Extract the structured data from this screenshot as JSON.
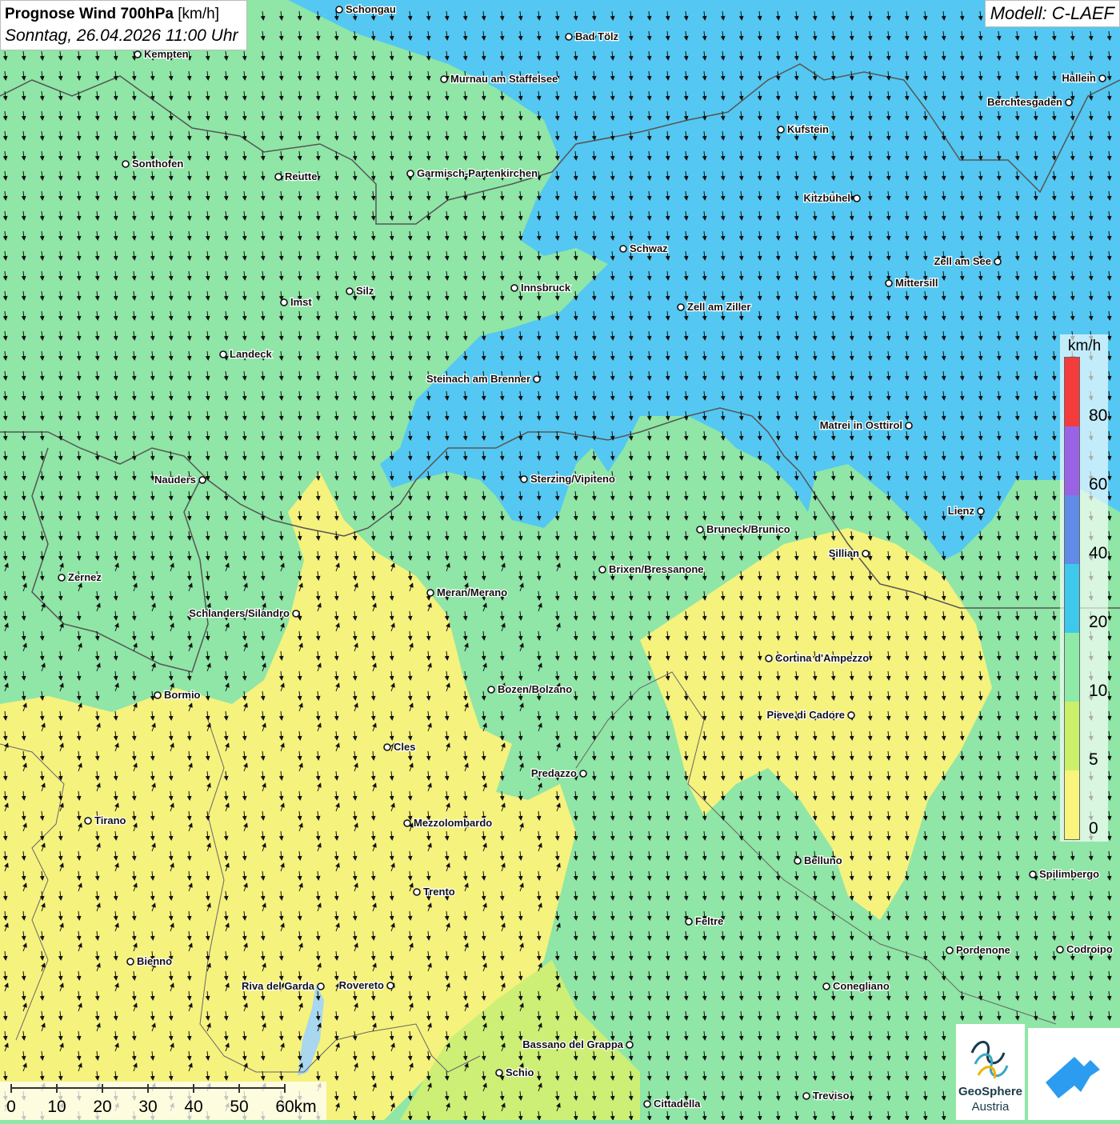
{
  "title": {
    "main_bold": "Prognose Wind 700hPa",
    "main_unit": "[km/h]",
    "date": "Sonntag, 26.04.2026 11:00 Uhr"
  },
  "model": "Modell: C-LAEF",
  "legend": {
    "unit": "km/h",
    "labels": [
      "80",
      "60",
      "40",
      "20",
      "10",
      "5",
      "0"
    ],
    "colors": [
      "#f53c3c",
      "#9a63e6",
      "#5f8ce6",
      "#3ec8ec",
      "#8eeaa6",
      "#cbf06a",
      "#f8f47c"
    ]
  },
  "scale_bar": {
    "labels": [
      "0",
      "10",
      "20",
      "30",
      "40",
      "50",
      "60km"
    ]
  },
  "cities": [
    {
      "name": "Schongau"
    },
    {
      "name": "Bad Tölz"
    },
    {
      "name": "Kempten"
    },
    {
      "name": "Murnau am Staffelsee"
    },
    {
      "name": "Hallein"
    },
    {
      "name": "Berchtesgaden"
    },
    {
      "name": "Kufstein"
    },
    {
      "name": "Sonthofen"
    },
    {
      "name": "Reutte"
    },
    {
      "name": "Garmisch-Partenkirchen"
    },
    {
      "name": "Kitzbühel"
    },
    {
      "name": "Schwaz"
    },
    {
      "name": "Zell am See"
    },
    {
      "name": "Mittersill"
    },
    {
      "name": "Innsbruck"
    },
    {
      "name": "Silz"
    },
    {
      "name": "Imst"
    },
    {
      "name": "Zell am Ziller"
    },
    {
      "name": "Landeck"
    },
    {
      "name": "Steinach am Brenner"
    },
    {
      "name": "Matrei in Osttirol"
    },
    {
      "name": "Nauders"
    },
    {
      "name": "Sterzing/Vipiteno"
    },
    {
      "name": "Lienz"
    },
    {
      "name": "Bruneck/Brunico"
    },
    {
      "name": "Sillian"
    },
    {
      "name": "Brixen/Bressanone"
    },
    {
      "name": "Zernez"
    },
    {
      "name": "Meran/Merano"
    },
    {
      "name": "Schlanders/Silandro"
    },
    {
      "name": "Cortina d'Ampezzo"
    },
    {
      "name": "Bozen/Bolzano"
    },
    {
      "name": "Bormio"
    },
    {
      "name": "Pieve di Cadore"
    },
    {
      "name": "Cles"
    },
    {
      "name": "Predazzo"
    },
    {
      "name": "Tirano"
    },
    {
      "name": "Mezzolombardo"
    },
    {
      "name": "Belluno"
    },
    {
      "name": "Spilimbergo"
    },
    {
      "name": "Trento"
    },
    {
      "name": "Feltre"
    },
    {
      "name": "Pordenone"
    },
    {
      "name": "Codroipo"
    },
    {
      "name": "Bienno"
    },
    {
      "name": "Riva del Garda"
    },
    {
      "name": "Rovereto"
    },
    {
      "name": "Conegliano"
    },
    {
      "name": "Bassano del Grappa"
    },
    {
      "name": "Schio"
    },
    {
      "name": "Treviso"
    },
    {
      "name": "Cittadella"
    }
  ],
  "logos": {
    "geosphere_line1": "GeoSphere",
    "geosphere_line2": "Austria"
  }
}
